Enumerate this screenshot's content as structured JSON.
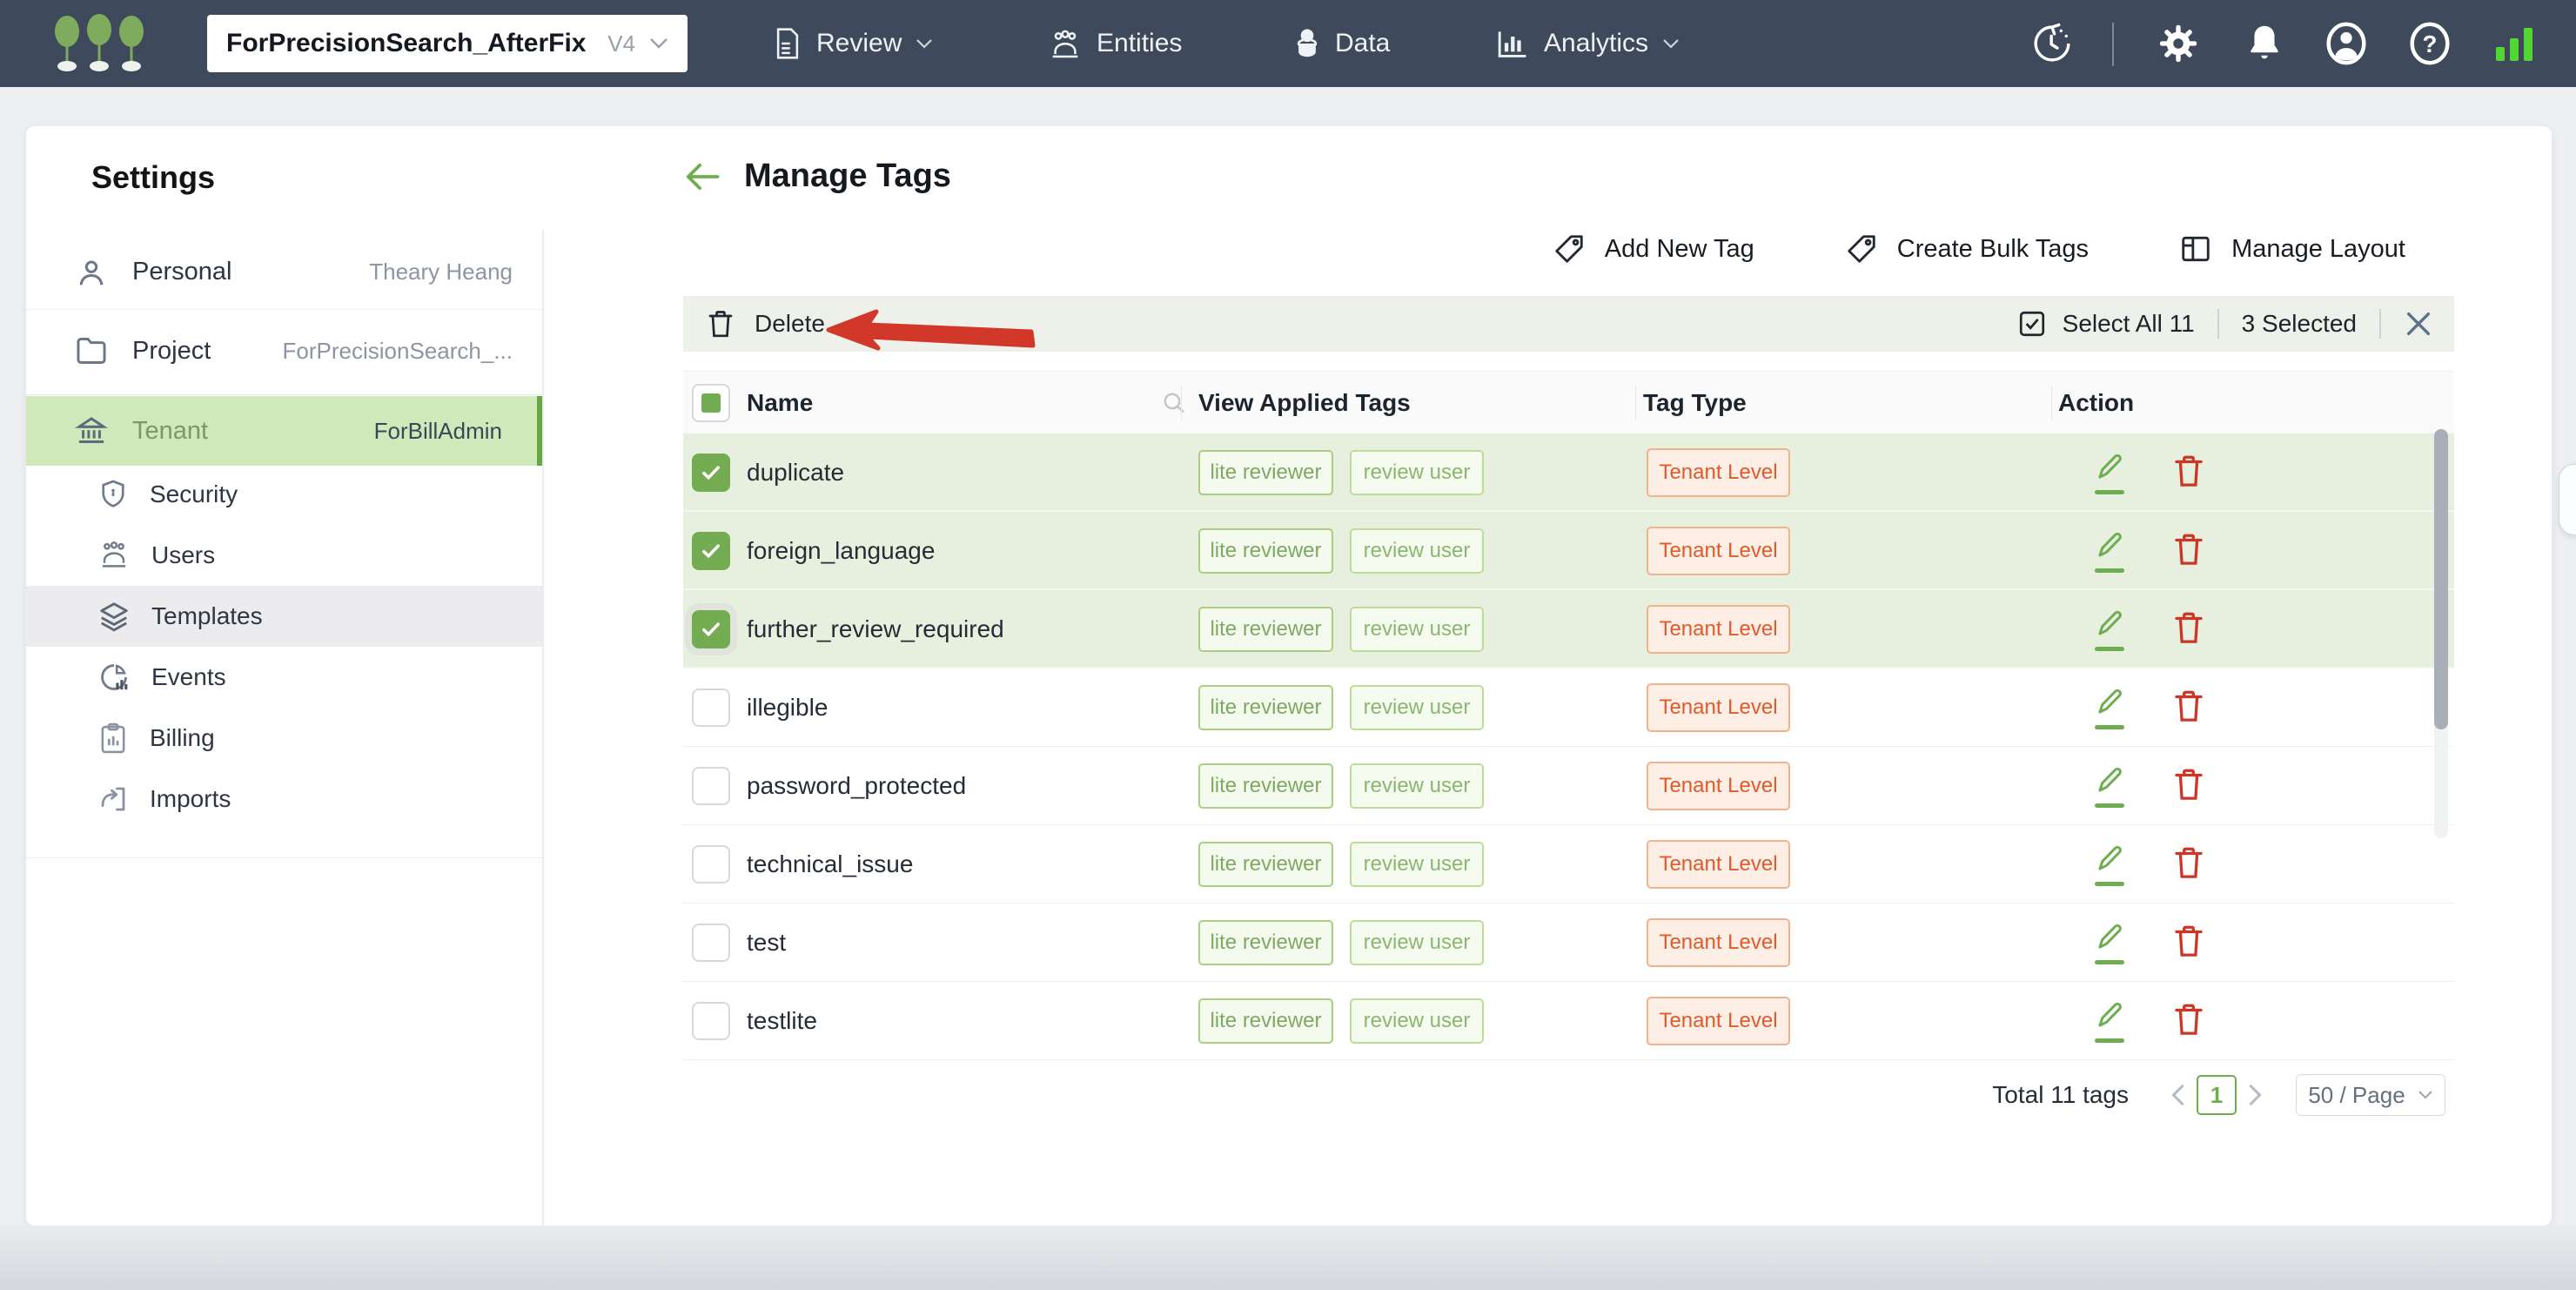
{
  "topbar": {
    "project_selector": {
      "name": "ForPrecisionSearch_AfterFix",
      "version": "V4"
    },
    "nav": [
      {
        "label": "Review",
        "icon": "document-icon",
        "has_caret": true
      },
      {
        "label": "Entities",
        "icon": "people-icon",
        "has_caret": false
      },
      {
        "label": "Data",
        "icon": "database-icon",
        "has_caret": false
      },
      {
        "label": "Analytics",
        "icon": "bar-chart-icon",
        "has_caret": true
      }
    ],
    "right_icons": [
      "history-icon",
      "gear-icon",
      "bell-icon",
      "user-icon",
      "help-icon",
      "signal-bars-icon"
    ]
  },
  "sidebar": {
    "title": "Settings",
    "items": [
      {
        "label": "Personal",
        "value": "Theary Heang",
        "icon": "person-icon"
      },
      {
        "label": "Project",
        "value": "ForPrecisionSearch_...",
        "icon": "folder-icon"
      },
      {
        "label": "Tenant",
        "value": "ForBillAdmin",
        "icon": "bank-icon",
        "selected": true
      }
    ],
    "tenant_children": [
      {
        "label": "Security",
        "icon": "shield-icon"
      },
      {
        "label": "Users",
        "icon": "users-icon"
      },
      {
        "label": "Templates",
        "icon": "layers-icon",
        "active": true
      },
      {
        "label": "Events",
        "icon": "pie-chart-icon"
      },
      {
        "label": "Billing",
        "icon": "clipboard-icon"
      },
      {
        "label": "Imports",
        "icon": "import-icon"
      }
    ]
  },
  "main": {
    "title": "Manage Tags",
    "actions": {
      "add": "Add New Tag",
      "bulk": "Create Bulk Tags",
      "layout": "Manage Layout"
    },
    "bulkbar": {
      "delete": "Delete",
      "select_all": "Select All 11",
      "selected": "3 Selected"
    },
    "table": {
      "columns": [
        "Name",
        "View Applied Tags",
        "Tag Type",
        "Action"
      ],
      "rows": [
        {
          "name": "duplicate",
          "tags": [
            "lite reviewer",
            "review user"
          ],
          "type": "Tenant Level",
          "checked": true
        },
        {
          "name": "foreign_language",
          "tags": [
            "lite reviewer",
            "review user"
          ],
          "type": "Tenant Level",
          "checked": true
        },
        {
          "name": "further_review_required",
          "tags": [
            "lite reviewer",
            "review user"
          ],
          "type": "Tenant Level",
          "checked": true
        },
        {
          "name": "illegible",
          "tags": [
            "lite reviewer",
            "review user"
          ],
          "type": "Tenant Level",
          "checked": false
        },
        {
          "name": "password_protected",
          "tags": [
            "lite reviewer",
            "review user"
          ],
          "type": "Tenant Level",
          "checked": false
        },
        {
          "name": "technical_issue",
          "tags": [
            "lite reviewer",
            "review user"
          ],
          "type": "Tenant Level",
          "checked": false
        },
        {
          "name": "test",
          "tags": [
            "lite reviewer",
            "review user"
          ],
          "type": "Tenant Level",
          "checked": false
        },
        {
          "name": "testlite",
          "tags": [
            "lite reviewer",
            "review user"
          ],
          "type": "Tenant Level",
          "checked": false
        }
      ]
    },
    "footer": {
      "total": "Total 11 tags",
      "page": "1",
      "page_size": "50 / Page"
    }
  },
  "colors": {
    "topbar_bg": "#3e4a5c",
    "accent_green": "#6fae50",
    "selected_row_bg": "#e7f0df",
    "sidebar_selected_bg": "#cfe9ba",
    "tag_green_border": "#a9cf82",
    "tag_type_text": "#e2592b",
    "danger_red": "#cd3626",
    "annotation_red": "#d2382a",
    "signal_green": "#52d633"
  }
}
